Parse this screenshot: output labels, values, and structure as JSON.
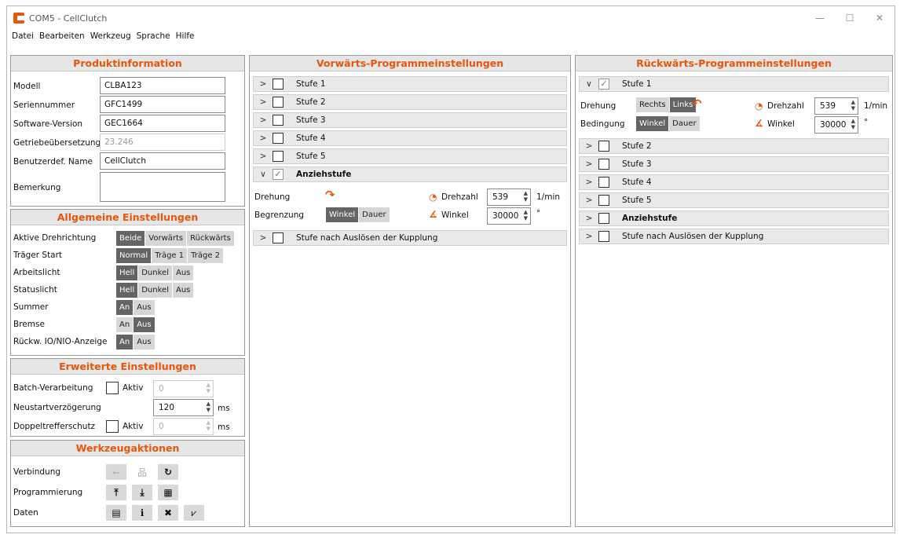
{
  "window": {
    "title": "COM5 - CellClutch",
    "min": "—",
    "max": "☐",
    "close": "✕"
  },
  "menu": [
    "Datei",
    "Bearbeiten",
    "Werkzeug",
    "Sprache",
    "Hilfe"
  ],
  "product": {
    "title": "Produktinformation",
    "model_label": "Modell",
    "model": "CLBA123",
    "serial_label": "Seriennummer",
    "serial": "GFC1499",
    "sw_label": "Software-Version",
    "sw": "GEC1664",
    "gear_label": "Getriebeübersetzung",
    "gear": "23.246",
    "name_label": "Benutzerdef. Name",
    "name": "CellClutch",
    "note_label": "Bemerkung",
    "note": ""
  },
  "general": {
    "title": "Allgemeine Einstellungen",
    "rows": [
      {
        "label": "Aktive Drehrichtung",
        "options": [
          "Beide",
          "Vorwärts",
          "Rückwärts"
        ],
        "selected": 0
      },
      {
        "label": "Träger Start",
        "options": [
          "Normal",
          "Träge 1",
          "Träge 2"
        ],
        "selected": 0
      },
      {
        "label": "Arbeitslicht",
        "options": [
          "Hell",
          "Dunkel",
          "Aus"
        ],
        "selected": 0
      },
      {
        "label": "Statuslicht",
        "options": [
          "Hell",
          "Dunkel",
          "Aus"
        ],
        "selected": 0
      },
      {
        "label": "Summer",
        "options": [
          "An",
          "Aus"
        ],
        "selected": 0
      },
      {
        "label": "Bremse",
        "options": [
          "An",
          "Aus"
        ],
        "selected": 1
      },
      {
        "label": "Rückw. IO/NIO-Anzeige",
        "options": [
          "An",
          "Aus"
        ],
        "selected": 0
      }
    ]
  },
  "extended": {
    "title": "Erweiterte Einstellungen",
    "batch_label": "Batch-Verarbeitung",
    "batch_active": "Aktiv",
    "batch_value": "0",
    "restart_label": "Neustartverzögerung",
    "restart_value": "120",
    "restart_unit": "ms",
    "double_label": "Doppeltrefferschutz",
    "double_active": "Aktiv",
    "double_value": "0",
    "double_unit": "ms"
  },
  "actions": {
    "title": "Werkzeugaktionen",
    "connection": "Verbindung",
    "programming": "Programmierung",
    "data": "Daten",
    "icons": {
      "usb": "⭠",
      "network": "品",
      "refresh": "↻",
      "upload": "⤒",
      "download": "⤓",
      "chip": "▦",
      "doc": "▤",
      "info": "ℹ",
      "tools": "✖",
      "chart": "⩗"
    }
  },
  "forward": {
    "title": "Vorwärts-Programmeinstellungen",
    "stages": [
      "Stufe 1",
      "Stufe 2",
      "Stufe 3",
      "Stufe 4",
      "Stufe 5"
    ],
    "tight": "Anziehstufe",
    "after": "Stufe nach Auslösen der Kupplung",
    "rotation_label": "Drehung",
    "limit_label": "Begrenzung",
    "limit_opts": [
      "Winkel",
      "Dauer"
    ],
    "speed_label": "Drehzahl",
    "speed": "539",
    "speed_unit": "1/min",
    "angle_label": "Winkel",
    "angle": "30000",
    "angle_unit": "°"
  },
  "backward": {
    "title": "Rückwärts-Programmeinstellungen",
    "stage1": "Stufe 1",
    "stages": [
      "Stufe 2",
      "Stufe 3",
      "Stufe 4",
      "Stufe 5"
    ],
    "tight": "Anziehstufe",
    "after": "Stufe nach Auslösen der Kupplung",
    "rotation_label": "Drehung",
    "rot_opts": [
      "Rechts",
      "Links"
    ],
    "cond_label": "Bedingung",
    "cond_opts": [
      "Winkel",
      "Dauer"
    ],
    "speed_label": "Drehzahl",
    "speed": "539",
    "speed_unit": "1/min",
    "angle_label": "Winkel",
    "angle": "30000",
    "angle_unit": "°"
  },
  "colors": {
    "accent": "#e8560a",
    "selected": "#646464",
    "button": "#d6d6d6"
  }
}
